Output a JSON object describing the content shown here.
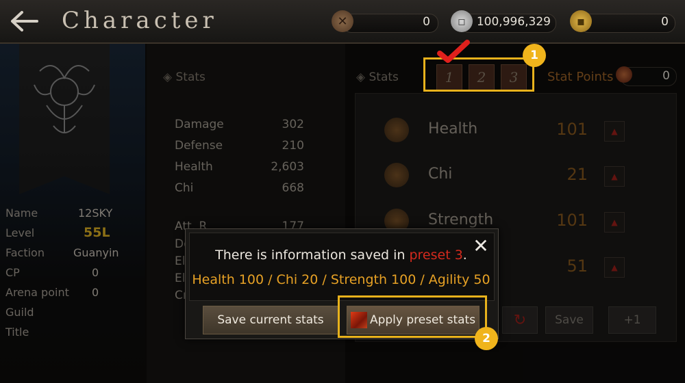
{
  "header": {
    "title": "Character",
    "currencies": [
      {
        "icon": "token-icon",
        "value": "0"
      },
      {
        "icon": "silver-coin-icon",
        "value": "100,996,329"
      },
      {
        "icon": "gold-coin-icon",
        "value": "0"
      }
    ]
  },
  "character": {
    "info": [
      {
        "label": "Name",
        "value": "12SKY"
      },
      {
        "label": "Level",
        "value": "55L"
      },
      {
        "label": "Faction",
        "value": "Guanyin"
      },
      {
        "label": "CP",
        "value": "0"
      },
      {
        "label": "Arena point",
        "value": "0"
      },
      {
        "label": "Guild",
        "value": ""
      },
      {
        "label": "Title",
        "value": ""
      }
    ]
  },
  "stats": {
    "heading": "Stats",
    "primary": [
      {
        "label": "Damage",
        "value": "302"
      },
      {
        "label": "Defense",
        "value": "210"
      },
      {
        "label": "Health",
        "value": "2,603"
      },
      {
        "label": "Chi",
        "value": "668"
      }
    ],
    "secondary": [
      {
        "label": "Att. R",
        "value": "177"
      },
      {
        "label": "Do",
        "value": ""
      },
      {
        "label": "Ele",
        "value": ""
      },
      {
        "label": "Ele",
        "value": ""
      },
      {
        "label": "Cri",
        "value": ""
      }
    ]
  },
  "allocation": {
    "heading": "Stats",
    "presets": [
      "1",
      "2",
      "3"
    ],
    "stat_points_label": "Stat Points",
    "stat_points_value": "0",
    "attributes": [
      {
        "label": "Health",
        "value": "101"
      },
      {
        "label": "Chi",
        "value": "21"
      },
      {
        "label": "Strength",
        "value": "101"
      },
      {
        "label": "",
        "value": "51"
      }
    ],
    "save_label": "Save",
    "plus_label": "+1"
  },
  "dialog": {
    "message_prefix": "There is information saved in ",
    "message_preset": "preset 3",
    "message_suffix": ".",
    "stats_line": "Health 100 / Chi 20 / Strength 100 / Agility 50",
    "save_current_label": "Save current stats",
    "apply_preset_label": "Apply preset stats"
  },
  "annotations": {
    "badge_1": "1",
    "badge_2": "2"
  },
  "colors": {
    "highlight": "#e8b21c",
    "preset_text": "#d52a1e",
    "stats_line": "#e8a225",
    "checkmark": "#e0201c"
  }
}
